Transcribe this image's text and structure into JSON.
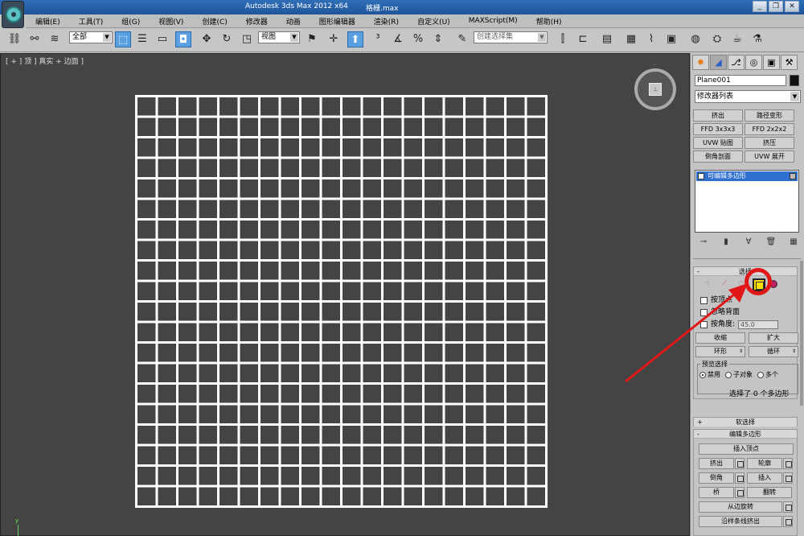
{
  "window": {
    "title": "Autodesk 3ds Max  2012 x64",
    "file": "格栅.max",
    "controls": [
      "_",
      "❐",
      "✕"
    ]
  },
  "menu": [
    "编辑(E)",
    "工具(T)",
    "组(G)",
    "视图(V)",
    "创建(C)",
    "修改器",
    "动画",
    "图形编辑器",
    "渲染(R)",
    "自定义(U)",
    "MAXScript(M)",
    "帮助(H)"
  ],
  "toolbar": {
    "filter_value": "全部",
    "coord_value": "视图",
    "named_selection_placeholder": "创建选择集"
  },
  "viewport": {
    "label": "[ + ] 顶 ] 真实 + 边面 ]",
    "grid_cells": 20,
    "plane_color": "#ffffff",
    "background": "#444444"
  },
  "command_panel": {
    "object_name": "Plane001",
    "object_color": "#111111",
    "modifier_list": "修改器列表",
    "modifier_buttons": [
      "挤出",
      "路径变形",
      "FFD 3x3x3",
      "FFD 2x2x2",
      "UVW 贴图",
      "挤压",
      "倒角剖面",
      "UVW 展开"
    ],
    "stack_item": "可编辑多边形",
    "selection": {
      "title": "选择",
      "by_vertex": "按顶点",
      "ignore_backfacing": "忽略背面",
      "by_angle": "按角度:",
      "angle_value": "45.0",
      "shrink": "收缩",
      "grow": "扩大",
      "ring": "环形",
      "loop": "循环",
      "preview_title": "预览选择",
      "preview_disabled": "禁用",
      "preview_subobject": "子对象",
      "preview_multi": "多个",
      "status": "选择了 0 个多边形"
    },
    "soft_selection": "软选择",
    "edit_polygons": {
      "title": "编辑多边形",
      "insert_vertex": "插入顶点",
      "extrude": "挤出",
      "outline": "轮廓",
      "bevel": "倒角",
      "inset": "插入",
      "bridge": "桥",
      "flip": "翻转",
      "hinge_from_edge": "从边旋转",
      "extrude_along_spline": "沿样条线挤出"
    }
  },
  "colors": {
    "highlight": "#e01818",
    "selected_mode": "#ffe000",
    "stack_select": "#2f6fd0"
  }
}
